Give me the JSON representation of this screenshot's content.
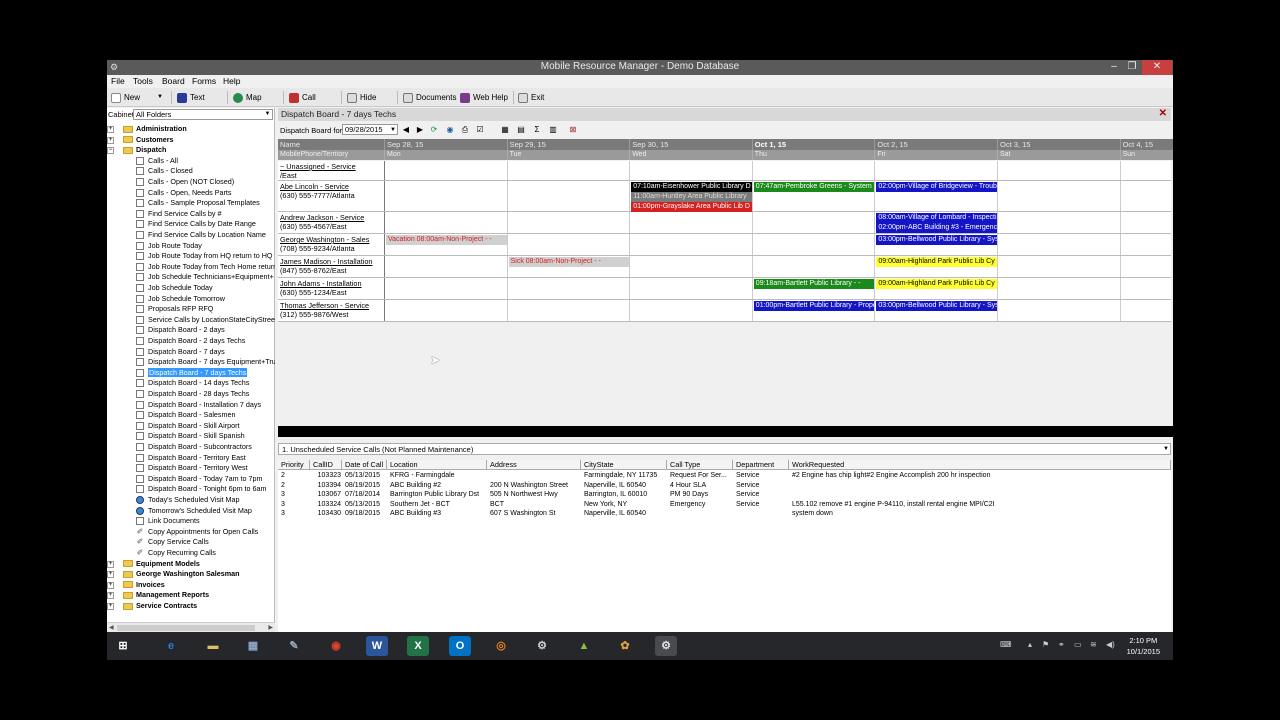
{
  "window": {
    "title": "Mobile Resource Manager - Demo Database",
    "minimize": "–",
    "restore": "❐",
    "close": "✕"
  },
  "menu": [
    "File",
    "Tools",
    "Board",
    "Forms",
    "Help"
  ],
  "toolbar": {
    "new": "New",
    "text": "Text",
    "map": "Map",
    "call": "Call",
    "hide": "Hide",
    "documents": "Documents",
    "webhelp": "Web Help",
    "exit": "Exit"
  },
  "cabinet": {
    "label": "Cabinet",
    "value": "All Folders"
  },
  "tree": {
    "administration": "Administration",
    "customers": "Customers",
    "dispatch": "Dispatch",
    "dispatch_items": [
      "Calls - All",
      "Calls - Closed",
      "Calls - Open (NOT Closed)",
      "Calls - Open, Needs Parts",
      "Calls - Sample Proposal Templates",
      "Find Service Calls by #",
      "Find Service Calls by Date Range",
      "Find Service Calls by Location Name",
      "Job Route Today",
      "Job Route Today from HQ return to HQ",
      "Job Route Today from Tech Home return",
      "Job Schedule Technicians+Equipment+",
      "Job Schedule Today",
      "Job Schedule Tomorrow",
      "Proposals RFP RFQ",
      "Service Calls by LocationStateCityStreet",
      "Dispatch Board -  2 days",
      "Dispatch Board -  2 days Techs",
      "Dispatch Board -  7 days",
      "Dispatch Board -  7 days Equipment+Tru",
      "Dispatch Board -  7 days Techs",
      "Dispatch Board - 14 days Techs",
      "Dispatch Board - 28 days Techs",
      "Dispatch Board - Installation 7 days",
      "Dispatch Board - Salesmen",
      "Dispatch Board - Skill Airport",
      "Dispatch Board - Skill Spanish",
      "Dispatch Board - Subcontractors",
      "Dispatch Board - Territory East",
      "Dispatch Board - Territory West",
      "Dispatch Board - Today 7am to 7pm",
      "Dispatch Board - Tonight 6pm to 6am",
      "Today's Scheduled Visit Map",
      "Tomorrow's Scheduled Visit Map",
      "Link Documents",
      "Copy Appointments for Open Calls",
      "Copy Service Calls",
      "Copy Recurring Calls"
    ],
    "others": [
      "Equipment Models",
      "George Washington Salesman",
      "Invoices",
      "Management Reports",
      "Service Contracts"
    ]
  },
  "board": {
    "title": "Dispatch Board - 7 days Techs",
    "for_label": "Dispatch Board for",
    "date": "09/28/2015",
    "headers": {
      "name": "Name",
      "name_sub": "MobilePhone/Territory",
      "days": [
        {
          "date": "Sep 28, 15",
          "dow": "Mon"
        },
        {
          "date": "Sep 29, 15",
          "dow": "Tue"
        },
        {
          "date": "Sep 30, 15",
          "dow": "Wed"
        },
        {
          "date": "Oct 1, 15",
          "dow": "Thu"
        },
        {
          "date": "Oct 2, 15",
          "dow": "Fri"
        },
        {
          "date": "Oct 3, 15",
          "dow": "Sat"
        },
        {
          "date": "Oct 4, 15",
          "dow": "Sun"
        }
      ]
    },
    "rows": [
      {
        "name": "~ Unassigned - Service",
        "sub": "/East"
      },
      {
        "name": "Abe Lincoln - Service",
        "sub": "(630) 555-7777/Atlanta"
      },
      {
        "name": "Andrew Jackson - Service",
        "sub": "(630) 555-4567/East"
      },
      {
        "name": "George Washington - Sales",
        "sub": "(708) 555-9234/Atlanta"
      },
      {
        "name": "James Madison - Installation",
        "sub": "(847) 555-8762/East"
      },
      {
        "name": "John Adams - Installation",
        "sub": "(630) 555-1234/East"
      },
      {
        "name": "Thomas Jefferson - Service",
        "sub": "(312) 555-9876/West"
      }
    ],
    "appointments": [
      {
        "text": "07:10am-Eisenhower Public Library D",
        "bg": "#000000",
        "fg": "#ffffff"
      },
      {
        "text": "11:00am-Huntley Area Public Library",
        "bg": "#7a7a7a",
        "fg": "#dddddd"
      },
      {
        "text": "01:00pm-Grayslake Area Public Lib D",
        "bg": "#d42020",
        "fg": "#ffffff"
      },
      {
        "text": "07:47am-Pembroke Greens - System",
        "bg": "#1a8a1a",
        "fg": "#ffffff"
      },
      {
        "text": "02:00pm-Village of Bridgeview - Troub",
        "bg": "#1515c8",
        "fg": "#ffffff"
      },
      {
        "text": "08:00am-Village of Lombard - Inspecti",
        "bg": "#1515c8",
        "fg": "#ffffff"
      },
      {
        "text": "02:00pm-ABC Building #3 - Emergenc",
        "bg": "#1515c8",
        "fg": "#ffffff"
      },
      {
        "text": "Vacation 08:00am-Non-Project -  -",
        "bg": "#d0d0d0",
        "fg": "#d42020"
      },
      {
        "text": "03:00pm-Bellwood Public Library - Sys",
        "bg": "#1515c8",
        "fg": "#ffffff"
      },
      {
        "text": "Sick 08:00am-Non-Project -  -",
        "bg": "#d0d0d0",
        "fg": "#d42020"
      },
      {
        "text": "09:00am-Highland Park Public Lib Cy",
        "bg": "#ffff30",
        "fg": "#000000"
      },
      {
        "text": "09:18am-Bartlett Public Library -  -",
        "bg": "#1a8a1a",
        "fg": "#ffffff"
      },
      {
        "text": "09:00am-Highland Park Public Lib Cy",
        "bg": "#ffff30",
        "fg": "#000000"
      },
      {
        "text": "01:00pm-Bartlett Public Library - Propo",
        "bg": "#1515c8",
        "fg": "#ffffff"
      },
      {
        "text": "03:00pm-Bellwood Public Library - Sys",
        "bg": "#1515c8",
        "fg": "#ffffff"
      }
    ]
  },
  "unscheduled": {
    "title": "1. Unscheduled Service Calls (Not Planned Maintenance)",
    "columns": [
      "Priority",
      "CallID",
      "Date of Call",
      "Location",
      "Address",
      "CityState",
      "Call Type",
      "Department",
      "WorkRequested"
    ],
    "rows": [
      [
        "2",
        "103323",
        "05/13/2015",
        "KFRG - Farmingdale",
        "",
        "Farmingdale, NY  11735",
        "Request For Ser...",
        "Service",
        "#2 Engine has chip light#2 Engine Accomplish 200 hr inspection"
      ],
      [
        "2",
        "103394",
        "08/19/2015",
        "ABC Building #2",
        "200 N Washington Street",
        "Naperville, IL  60540",
        "4 Hour SLA",
        "Service",
        ""
      ],
      [
        "3",
        "103067",
        "07/18/2014",
        "Barrington Public Library Dst",
        "505 N Northwest Hwy",
        "Barrington, IL  60010",
        "PM  90 Days",
        "Service",
        ""
      ],
      [
        "3",
        "103324",
        "05/13/2015",
        "Southern Jet - BCT",
        "BCT",
        "New York, NY",
        "Emergency",
        "Service",
        "L55.102 remove #1 engine P-94110, install rental engine MPI/C2I"
      ],
      [
        "3",
        "103430",
        "09/18/2015",
        "ABC Building #3",
        "607 S Washington St",
        "Naperville, IL  60540",
        "",
        "",
        "system down"
      ]
    ]
  },
  "taskbar": {
    "time": "2:10 PM",
    "date": "10/1/2015"
  },
  "colors": {
    "selection": "#3399ff",
    "titlebar": "#5a5a5a",
    "taskbar": "#26272b"
  }
}
